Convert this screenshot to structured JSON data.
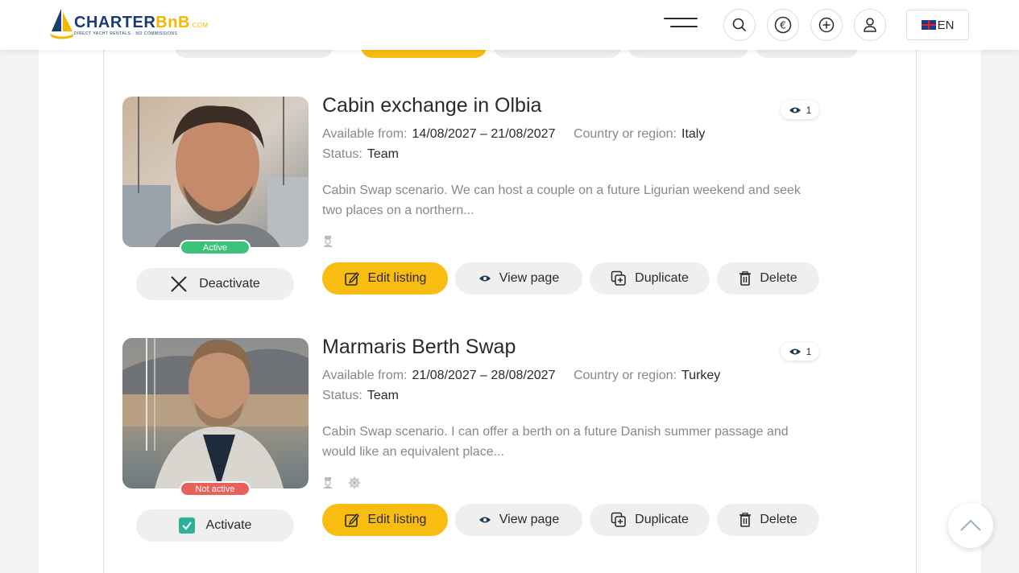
{
  "header": {
    "logo_main": "CHARTER",
    "logo_accent": "BnB",
    "logo_suffix": ".COM",
    "logo_tagline": "DIRECT YACHT RENTALS · NO COMMISSIONS",
    "language": "EN"
  },
  "listings": [
    {
      "title": "Cabin exchange in Olbia",
      "views": "1",
      "available_label": "Available from:",
      "available_value": "14/08/2027 – 21/08/2027",
      "country_label": "Country or region:",
      "country_value": "Italy",
      "status_label": "Status:",
      "status_value": "Team",
      "description": "Cabin Swap scenario. We can host a couple on a future Ligurian weekend and seek two places on a northern...",
      "badge": "Active",
      "toggle_label": "Deactivate",
      "edit_label": "Edit listing",
      "view_label": "View page",
      "duplicate_label": "Duplicate",
      "delete_label": "Delete"
    },
    {
      "title": "Marmaris Berth Swap",
      "views": "1",
      "available_label": "Available from:",
      "available_value": "21/08/2027 – 28/08/2027",
      "country_label": "Country or region:",
      "country_value": "Turkey",
      "status_label": "Status:",
      "status_value": "Team",
      "description": "Cabin Swap scenario. I can offer a berth on a future Danish summer passage and would like an equivalent place...",
      "badge": "Not active",
      "toggle_label": "Activate",
      "edit_label": "Edit listing",
      "view_label": "View page",
      "duplicate_label": "Duplicate",
      "delete_label": "Delete"
    }
  ],
  "colors": {
    "accent": "#f9bd12",
    "active": "#3cc27a",
    "inactive": "#e8605a"
  }
}
